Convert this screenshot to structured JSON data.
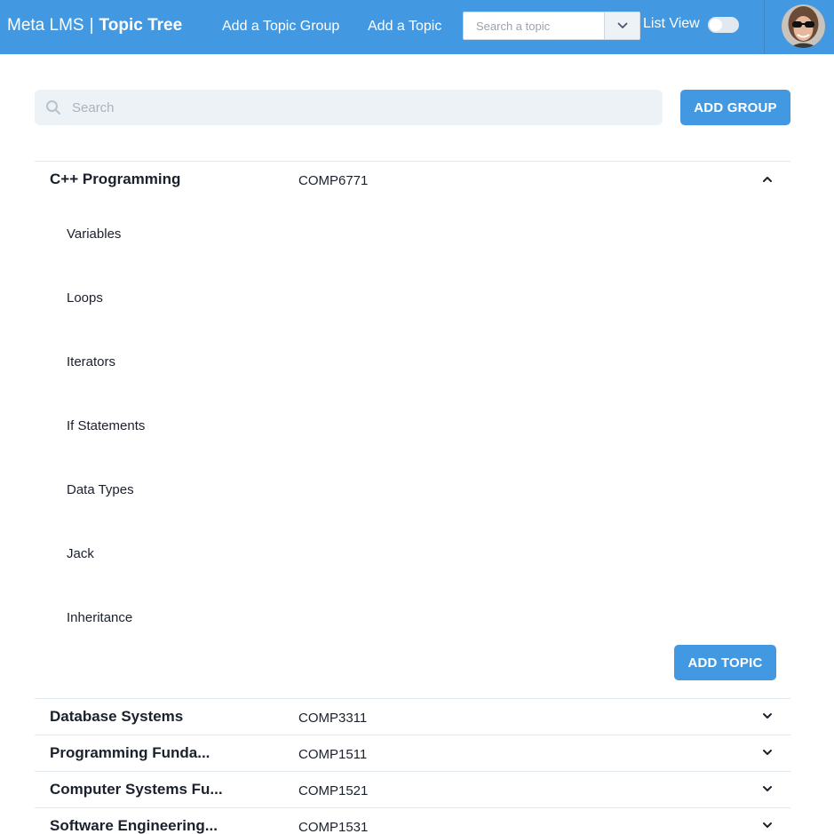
{
  "header": {
    "app_name": "Meta LMS",
    "separator": "|",
    "page_title": "Topic Tree",
    "nav": {
      "add_group": "Add a Topic Group",
      "add_topic": "Add a Topic"
    },
    "topic_select": {
      "placeholder": "Search a topic",
      "dropdown_icon": "chevron-down-icon"
    },
    "list_view": {
      "label": "List View",
      "enabled": false
    },
    "avatar": "user-avatar",
    "accent_color": "#4299e1"
  },
  "toolbar": {
    "search_placeholder": "Search",
    "search_icon": "search-icon",
    "add_group_label": "ADD GROUP"
  },
  "groups": [
    {
      "title": "C++ Programming",
      "code": "COMP6771",
      "expanded": true,
      "topics": [
        "Variables",
        "Loops",
        "Iterators",
        "If Statements",
        "Data Types",
        "Jack",
        "Inheritance"
      ],
      "add_topic_label": "ADD TOPIC"
    },
    {
      "title": "Database Systems",
      "code": "COMP3311",
      "expanded": false
    },
    {
      "title": "Programming Funda...",
      "code": "COMP1511",
      "expanded": false
    },
    {
      "title": "Computer Systems Fu...",
      "code": "COMP1521",
      "expanded": false
    },
    {
      "title": "Software Engineering...",
      "code": "COMP1531",
      "expanded": false
    }
  ]
}
